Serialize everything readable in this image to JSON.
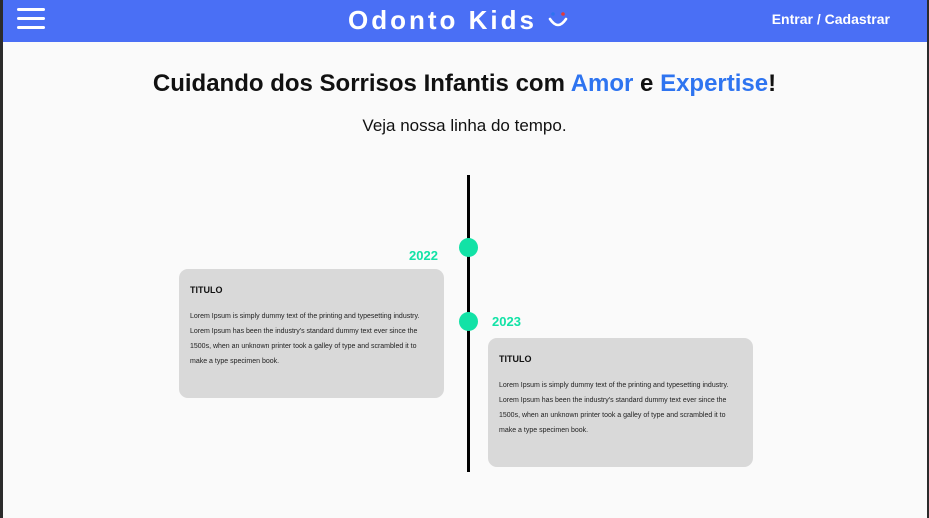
{
  "header": {
    "brand": "Odonto Kids",
    "login": "Entrar / Cadastrar",
    "colors": {
      "bar": "#4a6ff5",
      "smile_eyes": [
        "#2e74f0",
        "#e53935"
      ],
      "smile_mouth": "#ffffff"
    }
  },
  "hero": {
    "title_start": "Cuidando dos Sorrisos Infantis com ",
    "title_accent1": "Amor",
    "title_mid": " e ",
    "title_accent2": "Expertise",
    "title_end": "!",
    "subtitle": "Veja nossa linha do tempo.",
    "accent_color": "#2e74f0"
  },
  "timeline": {
    "marker_color": "#12e2a6",
    "items": [
      {
        "year": "2022",
        "title": "TITULO",
        "text": "Lorem Ipsum is simply dummy text of the printing and typesetting industry. Lorem Ipsum has been the industry's standard dummy text ever since the 1500s, when an unknown printer took a galley of type and scrambled it to make a type specimen book."
      },
      {
        "year": "2023",
        "title": "TITULO",
        "text": "Lorem Ipsum is simply dummy text of the printing and typesetting industry. Lorem Ipsum has been the industry's standard dummy text ever since the 1500s, when an unknown printer took a galley of type and scrambled it to make a type specimen book."
      }
    ]
  }
}
